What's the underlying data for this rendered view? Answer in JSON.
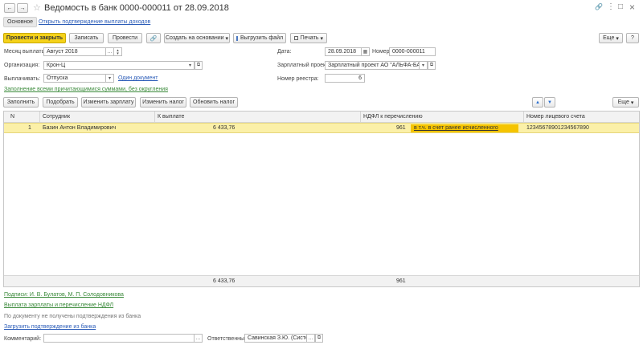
{
  "window": {
    "title": "Ведомость в банк 0000-000011 от 28.09.2018",
    "back": "←",
    "forward": "→",
    "star": "☆",
    "more": "⋮",
    "maximize": "□",
    "close": "×",
    "link": "🔗"
  },
  "tabs": {
    "main": "Основное",
    "confirm": "Открыть подтверждение выплаты доходов"
  },
  "toolbar": {
    "post_close": "Провести и закрыть",
    "save": "Записать",
    "post": "Провести",
    "attach_icon": "🔗",
    "create_based": "Создать на основании",
    "create_arrow": "▾",
    "upload_file": "Выгрузить файл",
    "print": "Печать",
    "print_arrow": "▾",
    "more": "Еще",
    "more_arrow": "▾",
    "help": "?"
  },
  "form": {
    "month_label": "Месяц выплаты:",
    "month_value": "Август 2018",
    "date_label": "Дата:",
    "date_value": "28.09.2018",
    "number_label": "Номер:",
    "number_value": "0000-000011",
    "org_label": "Организация:",
    "org_value": "Крон-Ц",
    "salary_project_label": "Зарплатный проект:",
    "salary_project_value": "Зарплатный проект АО \"АЛЬФА-БАНК\"",
    "pay_label": "Выплачивать:",
    "pay_value": "Отпуска",
    "one_doc_link": "Один документ",
    "registry_label": "Номер реестра:",
    "registry_value": "6",
    "fill_all_link": "Заполнение всеми причитающимися суммами, без округления"
  },
  "table_toolbar": {
    "fill": "Заполнить",
    "select": "Подобрать",
    "change_salary": "Изменить зарплату",
    "change_tax": "Изменить налог",
    "update_tax": "Обновить налог",
    "up": "▲",
    "down": "▼",
    "more": "Еще",
    "more_arrow": "▾"
  },
  "table": {
    "headers": {
      "n": "N",
      "employee": "Сотрудник",
      "to_pay": "К выплате",
      "ndfl": "НДФЛ к перечислению",
      "account": "Номер лицевого счета"
    },
    "rows": [
      {
        "n": "1",
        "employee": "Базин Антон Владимирович",
        "to_pay": "6 433,76",
        "ndfl": "961",
        "ndfl_note": "в т.ч. в счет ранее исчисленного",
        "account": "12345678901234567890"
      }
    ],
    "footer": {
      "to_pay": "6 433,76",
      "ndfl": "961"
    }
  },
  "bottom": {
    "signatures": "Подписи: И. В. Булатов, М. П. Солодовникова",
    "payout_link": "Выплата зарплаты и перечисление НДФЛ",
    "no_confirm": "По документу не получены подтверждения из банка",
    "load_confirm": "Загрузить подтверждение из банка",
    "comment_label": "Комментарий:",
    "comment_value": "",
    "responsible_label": "Ответственный:",
    "responsible_value": "Савинская З.Ю. (Системн"
  }
}
